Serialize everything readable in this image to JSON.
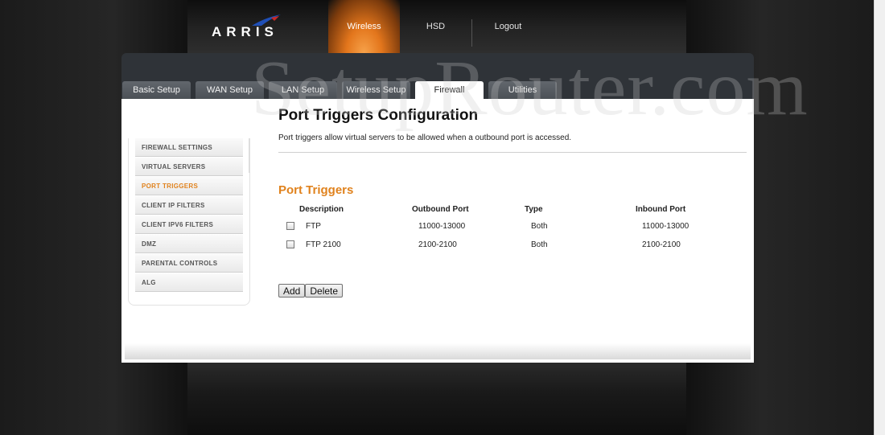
{
  "brand": {
    "logo_text": "ARRIS",
    "accent_color": "#e0821d",
    "swoosh_color": "#1f4fb7"
  },
  "top_nav": [
    {
      "label": "Wireless",
      "active": true
    },
    {
      "label": "HSD",
      "active": false
    },
    {
      "label": "Logout",
      "active": false
    }
  ],
  "tabs": [
    {
      "label": "Basic Setup",
      "active": false
    },
    {
      "label": "WAN Setup",
      "active": false
    },
    {
      "label": "LAN Setup",
      "active": false
    },
    {
      "label": "Wireless Setup",
      "active": false
    },
    {
      "label": "Firewall",
      "active": true
    },
    {
      "label": "Utilities",
      "active": false
    }
  ],
  "watermark": "SetupRouter.com",
  "side_menu": [
    {
      "label": "FIREWALL SETTINGS",
      "active": false
    },
    {
      "label": "VIRTUAL SERVERS",
      "active": false
    },
    {
      "label": "PORT TRIGGERS",
      "active": true
    },
    {
      "label": "CLIENT IP FILTERS",
      "active": false
    },
    {
      "label": "CLIENT IPV6 FILTERS",
      "active": false
    },
    {
      "label": "DMZ",
      "active": false
    },
    {
      "label": "PARENTAL CONTROLS",
      "active": false
    },
    {
      "label": "ALG",
      "active": false
    }
  ],
  "main": {
    "title": "Port Triggers Configuration",
    "description": "Port triggers allow virtual servers to be allowed when a outbound port is accessed.",
    "section_title": "Port Triggers",
    "columns": [
      "Description",
      "Outbound Port",
      "Type",
      "Inbound Port"
    ],
    "rows": [
      {
        "checked": false,
        "description": "FTP",
        "outbound": "11000-13000",
        "type": "Both",
        "inbound": "11000-13000"
      },
      {
        "checked": false,
        "description": "FTP 2100",
        "outbound": "2100-2100",
        "type": "Both",
        "inbound": "2100-2100"
      }
    ],
    "add_label": "Add",
    "delete_label": "Delete"
  }
}
